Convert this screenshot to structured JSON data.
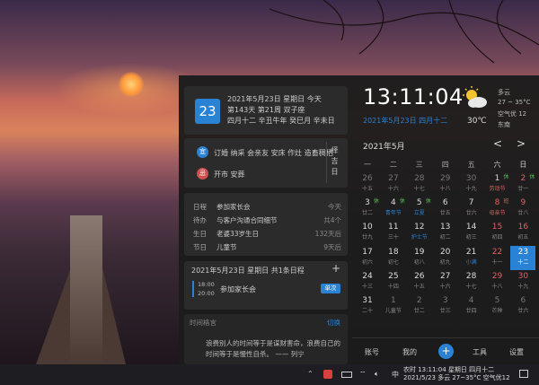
{
  "card1": {
    "day": "23",
    "line1": "2021年5月23日 星期日 今天",
    "line2": "第143天 第21周 双子座",
    "line3": "四月十二 辛丑牛年 癸巳月 辛未日"
  },
  "card2": {
    "yi_label": "宜",
    "yi_text": "订婚 纳采 会亲友 安床 作灶 造畜稠栖",
    "ji_label": "忌",
    "ji_text": "开市 安葬",
    "side": [
      "择",
      "吉",
      "日"
    ]
  },
  "events": [
    {
      "k": "日程",
      "v": "参加家长会",
      "r": "今天"
    },
    {
      "k": "待办",
      "v": "与客户沟通合同细节",
      "r": "共4个"
    },
    {
      "k": "生日",
      "v": "老婆33岁生日",
      "r": "132天后"
    },
    {
      "k": "节日",
      "v": "儿童节",
      "r": "9天后"
    }
  ],
  "schedule": {
    "title": "2021年5月23日 星期日 共1条日程",
    "add": "+",
    "start": "18:00",
    "end": "20:00",
    "name": "参加家长会",
    "badge": "单次"
  },
  "maxim": {
    "label": "时间格言",
    "switch": "切换",
    "text": "浪费别人的时间等于是谋财害命，浪费自己的时间等于是慢性自杀。 —— 列宁"
  },
  "clock": {
    "time": "13:11:04",
    "date": "2021年5月23日 四月十二"
  },
  "weather": {
    "cond": "多云",
    "range": "27 ~ 35°C",
    "aqi": "空气优 12",
    "wind": "东南",
    "temp": "30℃",
    "icon": "partly-cloudy-icon"
  },
  "calendar": {
    "month": "2021年5月",
    "prev": "<",
    "next": ">",
    "weekdays": [
      "一",
      "二",
      "三",
      "四",
      "五",
      "六",
      "日"
    ],
    "rows": [
      [
        [
          "26",
          "十五",
          "dim"
        ],
        [
          "27",
          "十六",
          "dim"
        ],
        [
          "28",
          "十七",
          "dim"
        ],
        [
          "29",
          "十八",
          "dim"
        ],
        [
          "30",
          "十九",
          "dim"
        ],
        [
          "1",
          "劳动节",
          "",
          "休",
          "rfest"
        ],
        [
          "2",
          "廿一",
          "red",
          "休",
          ""
        ]
      ],
      [
        [
          "3",
          "廿二",
          "",
          "休",
          ""
        ],
        [
          "4",
          "青年节",
          "",
          "休",
          "fest"
        ],
        [
          "5",
          "立夏",
          "",
          "休",
          "fest"
        ],
        [
          "6",
          "廿五",
          "",
          ""
        ],
        [
          "7",
          "廿六",
          "",
          ""
        ],
        [
          "8",
          "母亲节",
          "red",
          "班",
          "rfest"
        ],
        [
          "9",
          "廿八",
          "red"
        ]
      ],
      [
        [
          "10",
          "廿九",
          ""
        ],
        [
          "11",
          "三十",
          ""
        ],
        [
          "12",
          "护士节",
          "",
          "",
          "fest"
        ],
        [
          "13",
          "初二",
          ""
        ],
        [
          "14",
          "初三",
          ""
        ],
        [
          "15",
          "初四",
          "red"
        ],
        [
          "16",
          "初五",
          "red"
        ]
      ],
      [
        [
          "17",
          "初六",
          ""
        ],
        [
          "18",
          "初七",
          ""
        ],
        [
          "19",
          "初八",
          ""
        ],
        [
          "20",
          "初九",
          ""
        ],
        [
          "21",
          "小满",
          "",
          "",
          "fest"
        ],
        [
          "22",
          "十一",
          "red"
        ],
        [
          "23",
          "十二",
          "sel"
        ]
      ],
      [
        [
          "24",
          "十三",
          ""
        ],
        [
          "25",
          "十四",
          ""
        ],
        [
          "26",
          "十五",
          ""
        ],
        [
          "27",
          "十六",
          ""
        ],
        [
          "28",
          "十七",
          ""
        ],
        [
          "29",
          "十八",
          "red"
        ],
        [
          "30",
          "十九",
          "red"
        ]
      ],
      [
        [
          "31",
          "二十",
          ""
        ],
        [
          "1",
          "儿童节",
          "dim"
        ],
        [
          "2",
          "廿二",
          "dim"
        ],
        [
          "3",
          "廿三",
          "dim"
        ],
        [
          "4",
          "廿四",
          "dim"
        ],
        [
          "5",
          "芒种",
          "dim"
        ],
        [
          "6",
          "廿六",
          "dim"
        ]
      ]
    ]
  },
  "bottom": {
    "account": "账号",
    "mine": "我的",
    "add": "+",
    "tools": "工具",
    "settings": "设置"
  },
  "taskbar": {
    "ime": "中",
    "line1": "农时 13:11:04 星期日 四月十二",
    "line2": "2021/5/23 多云 27~35°C 空气优12"
  }
}
